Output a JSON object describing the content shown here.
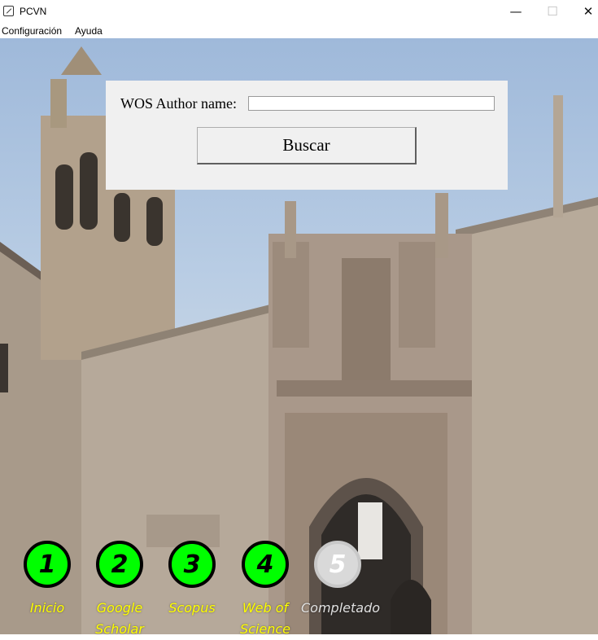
{
  "window": {
    "title": "PCVN",
    "minimize_glyph": "—",
    "maximize_glyph": "☐",
    "close_glyph": "✕"
  },
  "menu": {
    "items": [
      "Configuración",
      "Ayuda"
    ]
  },
  "search": {
    "label": "WOS Author name:",
    "value": "",
    "button_label": "Buscar"
  },
  "steps": [
    {
      "number": "1",
      "label": "Inicio",
      "state": "complete"
    },
    {
      "number": "2",
      "label": "Google Scholar",
      "state": "complete"
    },
    {
      "number": "3",
      "label": "Scopus",
      "state": "complete"
    },
    {
      "number": "4",
      "label": "Web of Science",
      "state": "current"
    },
    {
      "number": "5",
      "label": "Completado",
      "state": "pending"
    }
  ],
  "colors": {
    "step_active": "#00ff00",
    "step_label": "#ffff00",
    "step_inactive": "#d9d9d9",
    "panel_bg": "#f0f0f0"
  }
}
